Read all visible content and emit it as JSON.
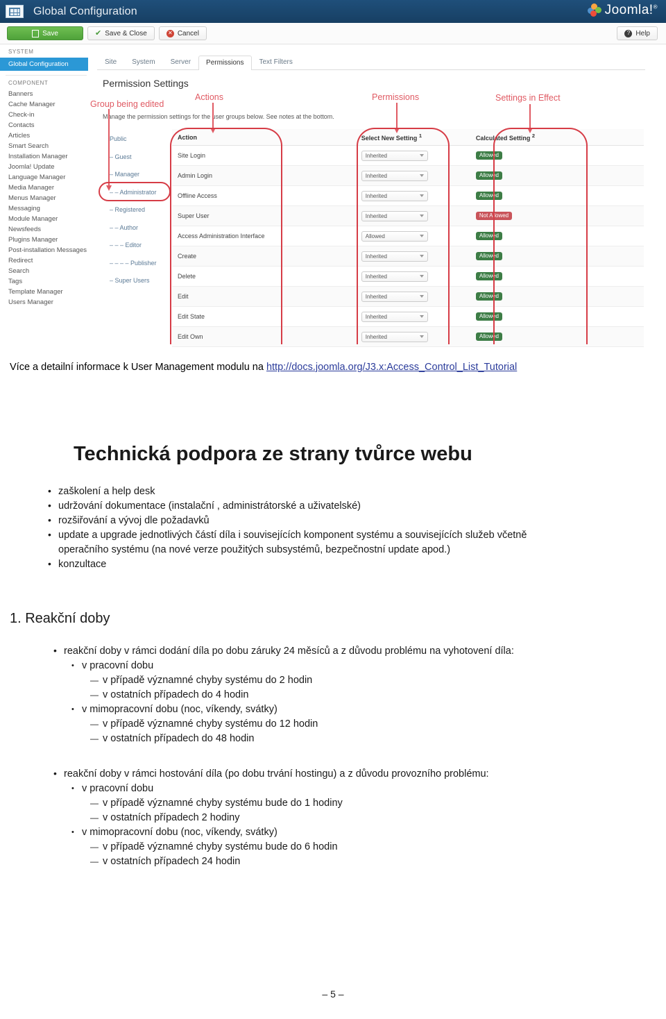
{
  "screenshot": {
    "header": {
      "title": "Global Configuration",
      "brand": "Joomla!",
      "brand_sup": "®"
    },
    "toolbar": {
      "save": "Save",
      "save_close": "Save & Close",
      "cancel": "Cancel",
      "help": "Help"
    },
    "sidebar": {
      "system_label": "SYSTEM",
      "system_active": "Global Configuration",
      "component_label": "COMPONENT",
      "items": [
        "Banners",
        "Cache Manager",
        "Check-in",
        "Contacts",
        "Articles",
        "Smart Search",
        "Installation Manager",
        "Joomla! Update",
        "Language Manager",
        "Media Manager",
        "Menus Manager",
        "Messaging",
        "Module Manager",
        "Newsfeeds",
        "Plugins Manager",
        "Post-installation Messages",
        "Redirect",
        "Search",
        "Tags",
        "Template Manager",
        "Users Manager"
      ]
    },
    "tabs": [
      {
        "label": "Site",
        "active": false
      },
      {
        "label": "System",
        "active": false
      },
      {
        "label": "Server",
        "active": false
      },
      {
        "label": "Permissions",
        "active": true
      },
      {
        "label": "Text Filters",
        "active": false
      }
    ],
    "panel": {
      "title": "Permission Settings",
      "description": "Manage the permission settings for the user groups below. See notes at the bottom."
    },
    "groups": [
      "Public",
      "– Guest",
      "– Manager",
      "– – Administrator",
      "– Registered",
      "– – Author",
      "– – – Editor",
      "– – – – Publisher",
      "– Super Users"
    ],
    "table": {
      "headers": {
        "action": "Action",
        "select": "Select New Setting",
        "select_sup": "1",
        "calculated": "Calculated Setting",
        "calculated_sup": "2"
      },
      "rows": [
        {
          "action": "Site Login",
          "setting": "Inherited",
          "calculated": "Allowed",
          "state": "allowed"
        },
        {
          "action": "Admin Login",
          "setting": "Inherited",
          "calculated": "Allowed",
          "state": "allowed"
        },
        {
          "action": "Offline Access",
          "setting": "Inherited",
          "calculated": "Allowed",
          "state": "allowed"
        },
        {
          "action": "Super User",
          "setting": "Inherited",
          "calculated": "Not Allowed",
          "state": "notallowed"
        },
        {
          "action": "Access Administration Interface",
          "setting": "Allowed",
          "calculated": "Allowed",
          "state": "allowed"
        },
        {
          "action": "Create",
          "setting": "Inherited",
          "calculated": "Allowed",
          "state": "allowed"
        },
        {
          "action": "Delete",
          "setting": "Inherited",
          "calculated": "Allowed",
          "state": "allowed"
        },
        {
          "action": "Edit",
          "setting": "Inherited",
          "calculated": "Allowed",
          "state": "allowed"
        },
        {
          "action": "Edit State",
          "setting": "Inherited",
          "calculated": "Allowed",
          "state": "allowed"
        },
        {
          "action": "Edit Own",
          "setting": "Inherited",
          "calculated": "Allowed",
          "state": "allowed"
        }
      ]
    },
    "annotations": {
      "group_being_edited": "Group being edited",
      "actions": "Actions",
      "permissions": "Permissions",
      "settings_in_effect": "Settings in Effect",
      "color": "#e05a63",
      "ring_color": "#d63c46"
    }
  },
  "document": {
    "link_line": {
      "prefix": "Více a detailní informace k User Management modulu na ",
      "url_text": "http://docs.joomla.org/J3.x:Access_Control_List_Tutorial",
      "url_color": "#2b3c9b"
    },
    "heading": "Technická podpora ze strany tvůrce webu",
    "intro_bullets": [
      "zaškolení a help desk",
      "udržování dokumentace (instalační , administrátorské a uživatelské)",
      "rozšiřování a vývoj dle požadavků",
      "update a upgrade jednotlivých částí díla i souvisejících komponent systému a souvisejících služeb včetně",
      "operačního systému (na nové verze použitých subsystémů, bezpečnostní update apod.)",
      "konzultace"
    ],
    "section1": {
      "heading": "1. Reakční doby",
      "block_a": {
        "lead": "reakční doby v rámci dodání díla po dobu záruky 24 měsíců a z důvodu problému na vyhotovení díla:",
        "sub1": "v pracovní dobu",
        "sub1_items": [
          "v případě významné chyby systému do 2 hodin",
          "v ostatních případech do 4 hodin"
        ],
        "sub2": "v mimopracovní dobu (noc, víkendy, svátky)",
        "sub2_items": [
          "v případě významné chyby systému do 12 hodin",
          "v ostatních případech do 48 hodin"
        ]
      },
      "block_b": {
        "lead": "reakční doby v rámci hostování díla (po dobu trvání hostingu) a z důvodu provozního problému:",
        "sub1": "v pracovní dobu",
        "sub1_items": [
          "v případě významné chyby systému bude do 1 hodiny",
          "v ostatních případech 2 hodiny"
        ],
        "sub2": "v mimopracovní dobu (noc, víkendy, svátky)",
        "sub2_items": [
          "v případě významné chyby systému bude do 6 hodin",
          "v ostatních případech 24 hodin"
        ]
      }
    },
    "footer": "– 5 –"
  }
}
